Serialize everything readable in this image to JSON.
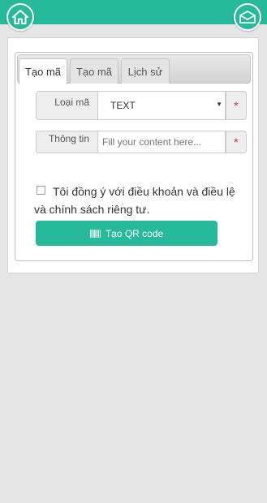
{
  "header": {
    "home_icon": "home-icon",
    "mail_icon": "mail-icon"
  },
  "tabs": [
    {
      "label": "Tạo mã",
      "active": true
    },
    {
      "label": "Tạo mã",
      "active": false
    },
    {
      "label": "Lịch sử",
      "active": false
    }
  ],
  "form": {
    "code_type_label": "Loại mã",
    "code_type_value": "TEXT",
    "info_label": "Thông tin",
    "info_placeholder": "Fill your content here...",
    "required_mark": "*",
    "agree_text": "Tôi đồng ý với điều khoản và điều lệ và chính sách riêng tư.",
    "submit_label": "Tạo QR code",
    "submit_icon": "barcode-icon"
  },
  "colors": {
    "accent": "#26b99a",
    "required": "#e03030"
  }
}
